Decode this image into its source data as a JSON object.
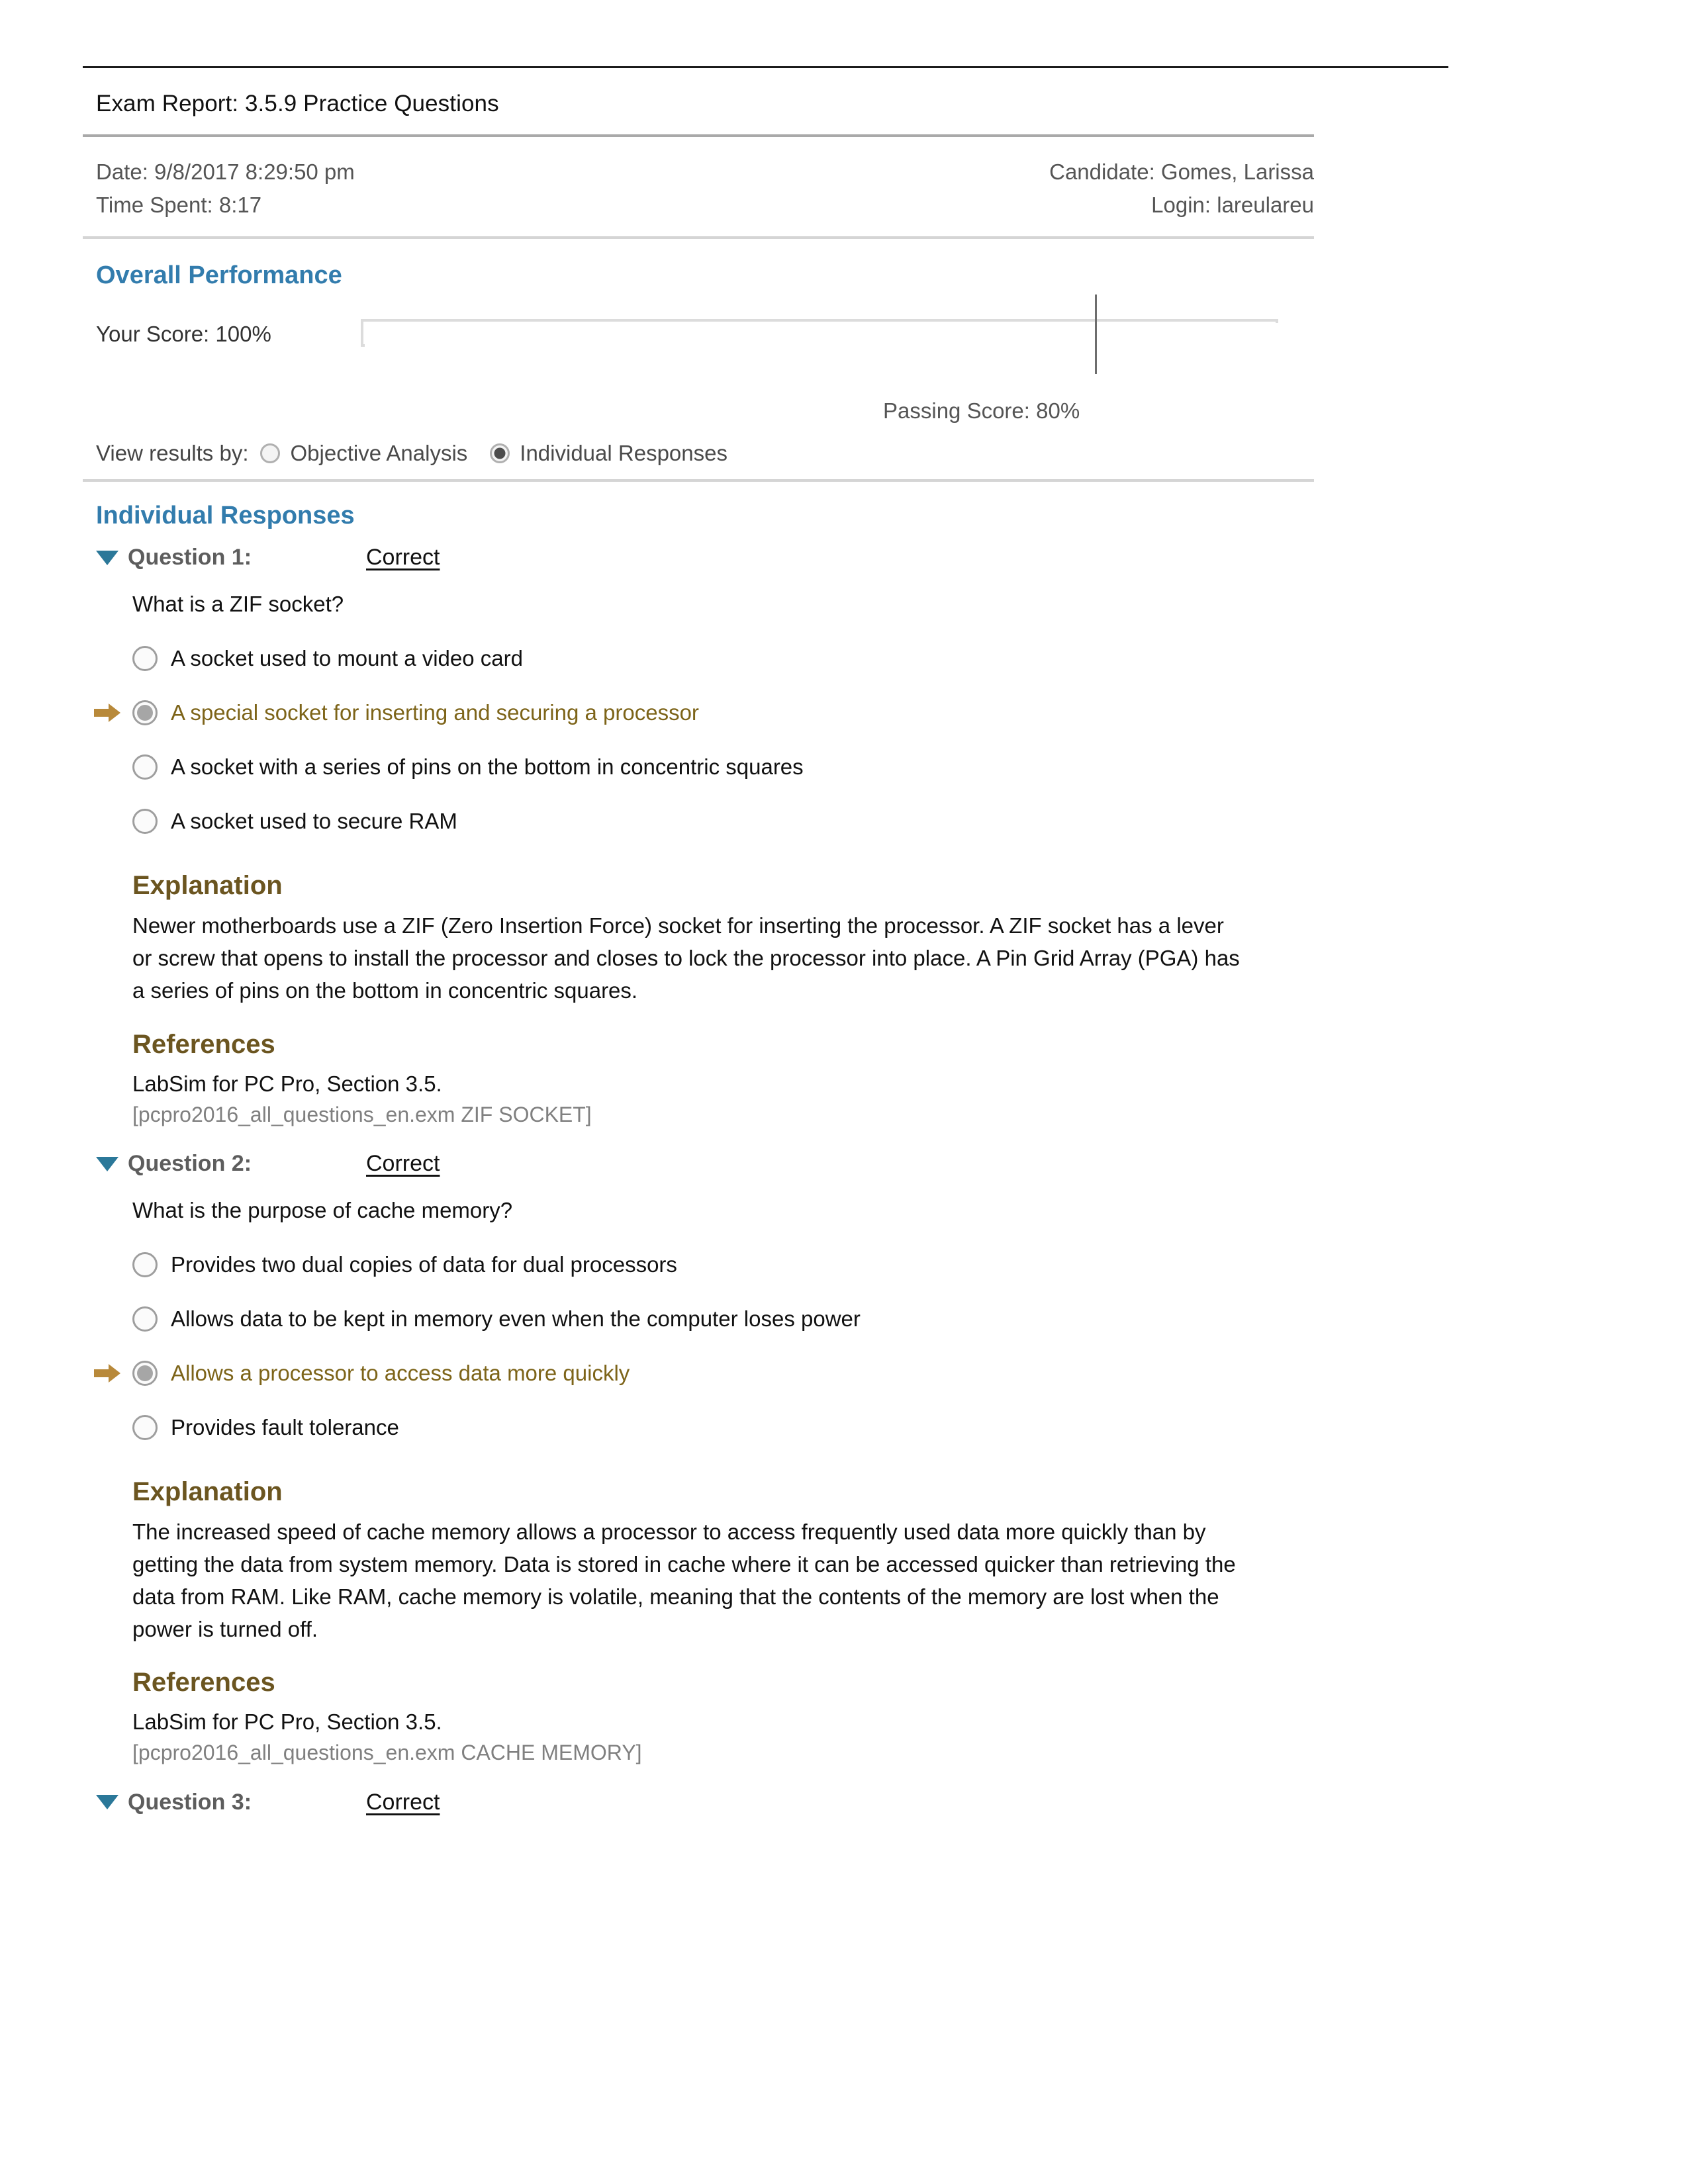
{
  "header": {
    "report_title": "Exam Report: 3.5.9 Practice Questions",
    "date_label": "Date: 9/8/2017 8:29:50 pm",
    "time_spent_label": "Time Spent: 8:17",
    "candidate_label": "Candidate: Gomes, Larissa",
    "login_label": "Login: lareulareu"
  },
  "overall": {
    "heading": "Overall Performance",
    "your_score_label": "Your Score: 100%",
    "your_score_percent": 100,
    "passing_score_label": "Passing Score: 80%",
    "passing_score_percent": 80,
    "bar_border_color": "#dcdcdc",
    "marker_color": "#6e6e6e"
  },
  "view_results": {
    "label": "View results by:",
    "options": [
      {
        "label": "Objective Analysis",
        "selected": false
      },
      {
        "label": "Individual Responses",
        "selected": true
      }
    ]
  },
  "individual_responses": {
    "heading": "Individual Responses",
    "accent_color": "#327cad",
    "triangle_color": "#2b7899",
    "selected_answer_color": "#7d6419",
    "arrow_color": "#b8893a",
    "sub_heading_color": "#6b5520"
  },
  "questions": [
    {
      "title": "Question 1:",
      "status": "Correct",
      "prompt": "What is a ZIF socket?",
      "answers": [
        {
          "text": "A socket used to mount a video card",
          "selected": false
        },
        {
          "text": "A special socket for inserting and securing a processor",
          "selected": true
        },
        {
          "text": "A socket with a series of pins on the bottom in concentric squares",
          "selected": false
        },
        {
          "text": "A socket used to secure RAM",
          "selected": false
        }
      ],
      "explanation_heading": "Explanation",
      "explanation": "Newer motherboards use a ZIF (Zero Insertion Force) socket for inserting the processor. A ZIF socket has a lever or screw that opens to install the processor and closes to lock the processor into place. A Pin Grid Array (PGA) has a series of pins on the bottom in concentric squares.",
      "references_heading": "References",
      "reference_line": "LabSim for PC Pro, Section 3.5.",
      "reference_source": "[pcpro2016_all_questions_en.exm ZIF SOCKET]"
    },
    {
      "title": "Question 2:",
      "status": "Correct",
      "prompt": "What is the purpose of cache memory?",
      "answers": [
        {
          "text": "Provides two dual copies of data for dual processors",
          "selected": false
        },
        {
          "text": "Allows data to be kept in memory even when the computer loses power",
          "selected": false
        },
        {
          "text": "Allows a processor to access data more quickly",
          "selected": true
        },
        {
          "text": "Provides fault tolerance",
          "selected": false
        }
      ],
      "explanation_heading": "Explanation",
      "explanation": "The increased speed of cache memory allows a processor to access frequently used data more quickly than by getting the data from system memory. Data is stored in cache where it can be accessed quicker than retrieving the data from RAM. Like RAM, cache memory is volatile, meaning that the contents of the memory are lost when the power is turned off.",
      "references_heading": "References",
      "reference_line": "LabSim for PC Pro, Section 3.5.",
      "reference_source": "[pcpro2016_all_questions_en.exm CACHE MEMORY]"
    },
    {
      "title": "Question 3:",
      "status": "Correct"
    }
  ]
}
